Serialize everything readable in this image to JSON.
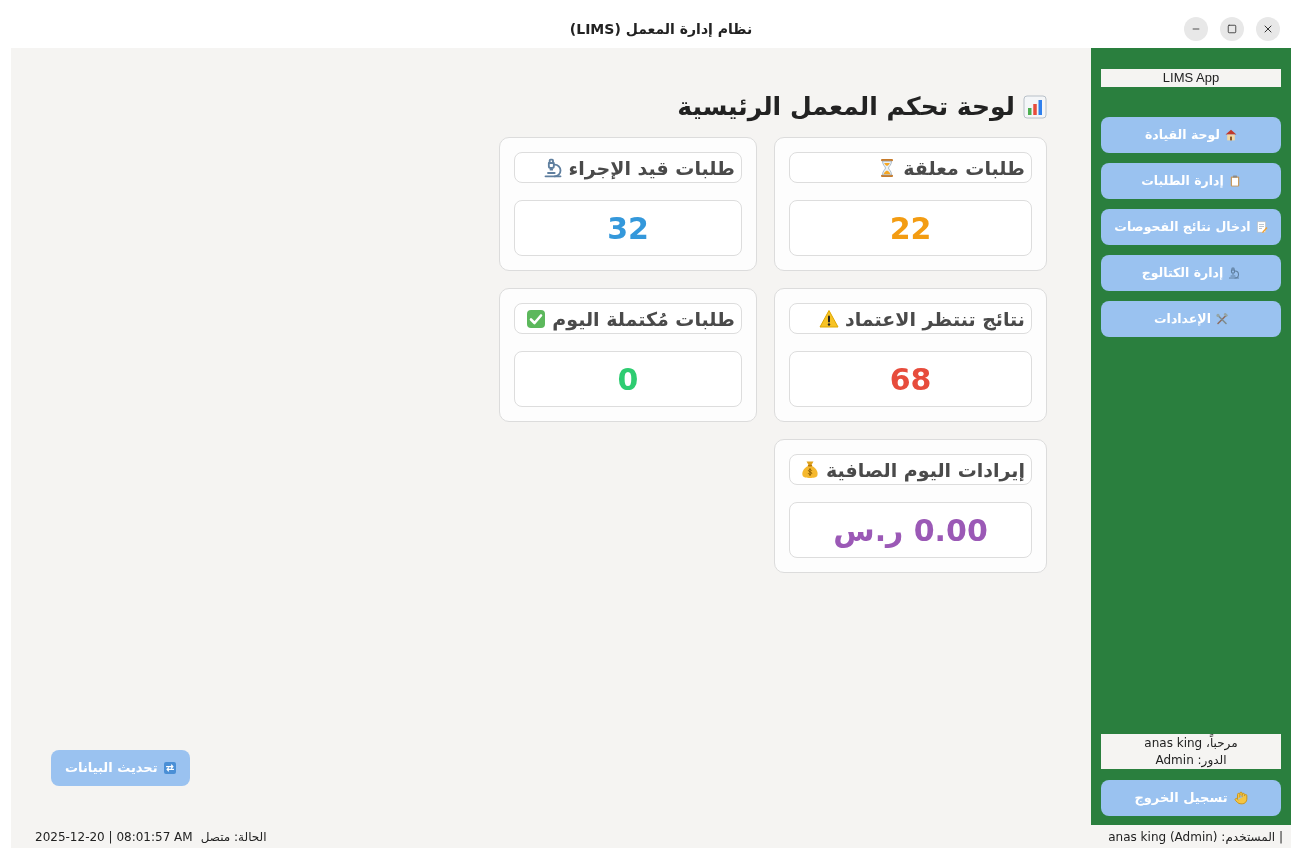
{
  "window": {
    "title": "نظام إدارة المعمل (LIMS)"
  },
  "dashboard": {
    "heading": "لوحة تحكم المعمل الرئيسية",
    "cards": [
      {
        "title": "طلبات معلقة",
        "value": "22",
        "color": "#f39c12"
      },
      {
        "title": "طلبات قيد الإجراء",
        "value": "32",
        "color": "#3498db"
      },
      {
        "title": "نتائج تنتظر الاعتماد",
        "value": "68",
        "color": "#e74c3c"
      },
      {
        "title": "طلبات مُكتملة اليوم",
        "value": "0",
        "color": "#2ecc71"
      },
      {
        "title": "إيرادات اليوم الصافية",
        "value": "0.00 ر.س",
        "color": "#9b59b6"
      }
    ],
    "refresh_button": "تحديث البيانات"
  },
  "sidebar": {
    "app_name": "LIMS App",
    "items": [
      {
        "label": "لوحة القيادة"
      },
      {
        "label": "إدارة الطلبات"
      },
      {
        "label": "ادخال نتائج الفحوصات"
      },
      {
        "label": "إدارة الكتالوج"
      },
      {
        "label": "الإعدادات"
      }
    ],
    "user_box": {
      "greeting": "مرحباً، anas king",
      "role": "الدور: Admin"
    },
    "logout_button": "تسجيل الخروج"
  },
  "status_bar": {
    "datetime": "2025-12-20 | 08:01:57 AM",
    "status": "الحالة: متصل",
    "user": "| المستخدم: anas king (Admin)"
  }
}
